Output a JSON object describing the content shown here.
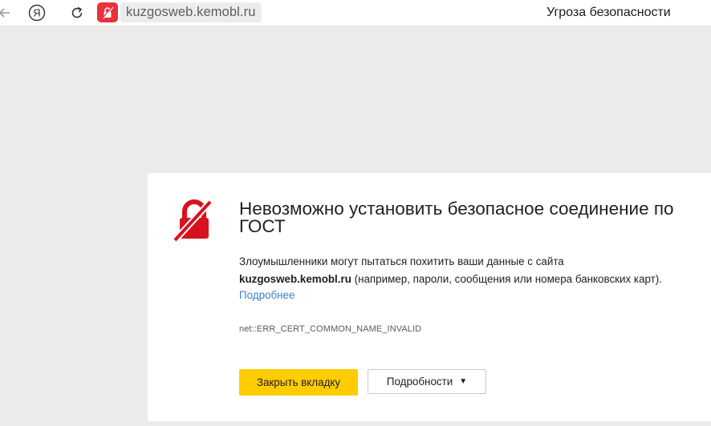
{
  "browser": {
    "url": "kuzgosweb.kemobl.ru",
    "page_title": "Угроза безопасности",
    "yandex_glyph": "Я"
  },
  "icons": {
    "back": "back-arrow-icon",
    "yandex": "yandex-icon",
    "reload": "reload-icon",
    "lock_broken": "broken-lock-icon",
    "caret": "caret-down-icon"
  },
  "colors": {
    "accent_red": "#e8323c",
    "icon_red": "#d7111f",
    "button_yellow": "#ffcc00",
    "link_blue": "#3a81d6"
  },
  "card": {
    "heading": "Невозможно установить безопасное соединение по ГОСТ",
    "desc_line1": "Злоумышленники могут пытаться похитить ваши данные с сайта",
    "desc_domain": "kuzgosweb.kemobl.ru",
    "desc_line2": " (например, пароли, сообщения или номера банковских карт).",
    "more_link": "Подробнее",
    "error_code": "net::ERR_CERT_COMMON_NAME_INVALID",
    "close_button": "Закрыть вкладку",
    "details_button": "Подробности",
    "details_caret": "▼"
  }
}
